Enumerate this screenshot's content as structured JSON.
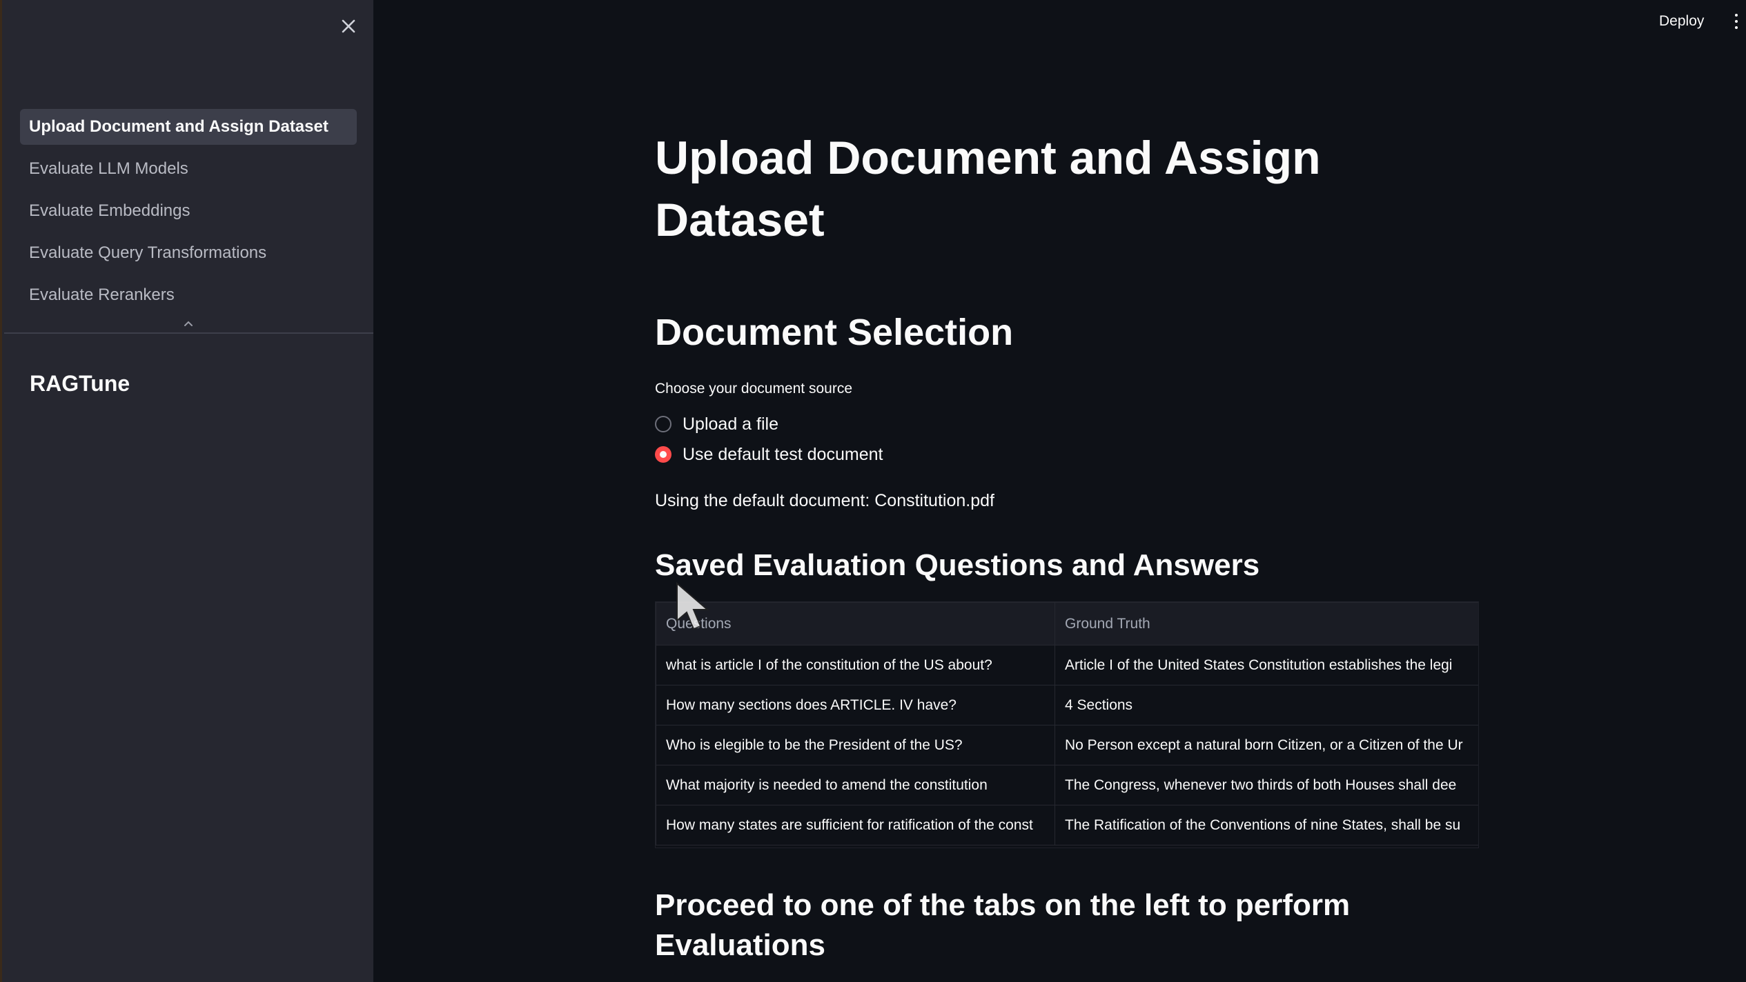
{
  "header": {
    "deploy_label": "Deploy"
  },
  "sidebar": {
    "items": [
      {
        "label": "Upload Document and Assign Dataset",
        "active": true
      },
      {
        "label": "Evaluate LLM Models",
        "active": false
      },
      {
        "label": "Evaluate Embeddings",
        "active": false
      },
      {
        "label": "Evaluate Query Transformations",
        "active": false
      },
      {
        "label": "Evaluate Rerankers",
        "active": false
      }
    ],
    "brand": "RAGTune"
  },
  "main": {
    "title": "Upload Document and Assign Dataset",
    "section_title": "Document Selection",
    "radio_label": "Choose your document source",
    "radio_options": [
      {
        "label": "Upload a file",
        "selected": false
      },
      {
        "label": "Use default test document",
        "selected": true
      }
    ],
    "info_text": "Using the default document: Constitution.pdf",
    "subsection_title": "Saved Evaluation Questions and Answers",
    "table": {
      "headers": [
        "Questions",
        "Ground Truth"
      ],
      "rows": [
        [
          "what is article I of the constitution of the US about?",
          "Article I of the United States Constitution establishes the legi"
        ],
        [
          "How many sections does ARTICLE. IV have?",
          "4 Sections"
        ],
        [
          "Who is elegible to be the President of the US?",
          "No Person except a natural born Citizen, or a Citizen of the Ur"
        ],
        [
          "What majority is needed to amend the constitution",
          "The Congress, whenever two thirds of both Houses shall dee"
        ],
        [
          "How many states are sufficient for ratification of the const",
          "The Ratification of the Conventions of nine States, shall be su"
        ]
      ]
    },
    "footer_text": "Proceed to one of the tabs on the left to perform Evaluations"
  },
  "colors": {
    "background": "#0e1117",
    "sidebar": "#262730",
    "accent": "#ff4b4b"
  }
}
